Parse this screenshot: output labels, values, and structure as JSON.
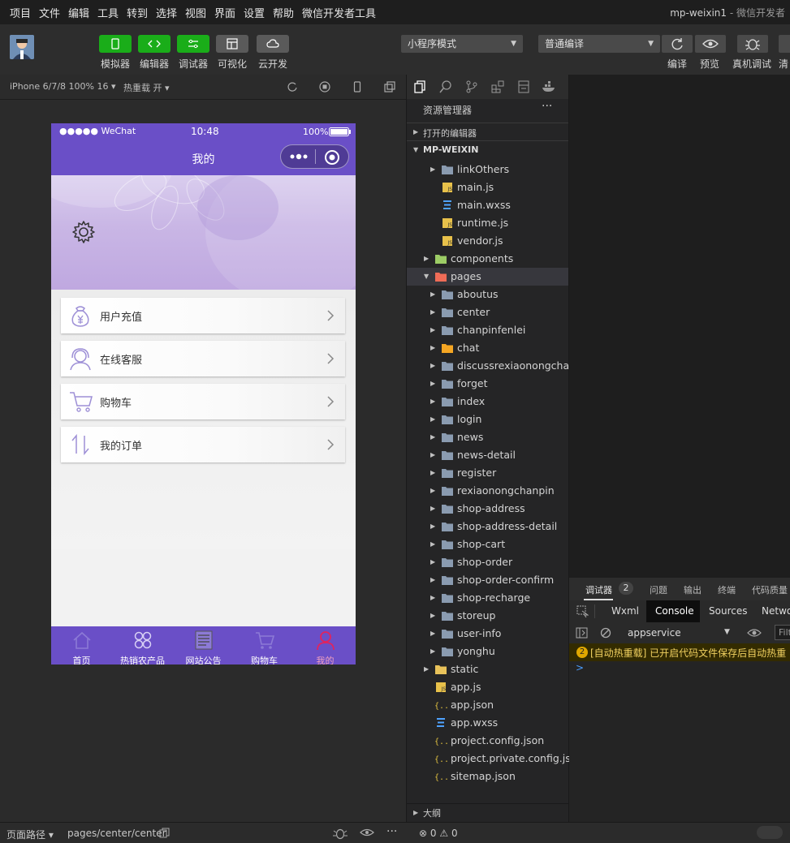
{
  "menubar": {
    "items": [
      "项目",
      "文件",
      "编辑",
      "工具",
      "转到",
      "选择",
      "视图",
      "界面",
      "设置",
      "帮助",
      "微信开发者工具"
    ],
    "window_title": "mp-weixin1",
    "window_title_suffix": " - 微信开发者"
  },
  "toolbar": {
    "buttons": [
      {
        "label": "模拟器",
        "icon": "phone-icon"
      },
      {
        "label": "编辑器",
        "icon": "code-icon"
      },
      {
        "label": "调试器",
        "icon": "debug-icon"
      },
      {
        "label": "可视化",
        "icon": "layout-icon"
      },
      {
        "label": "云开发",
        "icon": "cloud-icon"
      }
    ],
    "mode_select": "小程序模式",
    "compile_select": "普通编译",
    "right_labels": [
      "编译",
      "预览",
      "真机调试",
      "清"
    ]
  },
  "simulator": {
    "device": "iPhone 6/7/8 100% 16",
    "hot_reload": "热重载 开",
    "status": {
      "carrier": "●●●●● WeChat",
      "time": "10:48",
      "battery": "100%"
    },
    "nav_title": "我的",
    "menu_items": [
      {
        "label": "用户充值",
        "icon": "money-bag-icon"
      },
      {
        "label": "在线客服",
        "icon": "customer-service-icon"
      },
      {
        "label": "购物车",
        "icon": "cart-icon"
      },
      {
        "label": "我的订单",
        "icon": "sort-arrows-icon"
      }
    ],
    "tabs": [
      {
        "label": "首页",
        "icon": "home-icon",
        "active": false
      },
      {
        "label": "热销农产品",
        "icon": "grid-icon",
        "active": false
      },
      {
        "label": "网站公告",
        "icon": "news-icon",
        "active": false
      },
      {
        "label": "购物车",
        "icon": "cart-icon",
        "active": false
      },
      {
        "label": "我的",
        "icon": "user-icon",
        "active": true
      }
    ],
    "colors": {
      "primary": "#6a4fc7",
      "active_tab": "#e0245e"
    }
  },
  "explorer": {
    "title": "资源管理器",
    "open_editors": "打开的编辑器",
    "project": "MP-WEIXIN",
    "tree": [
      {
        "name": "linkOthers",
        "type": "folder",
        "depth": 2,
        "expandable": true
      },
      {
        "name": "main.js",
        "type": "js",
        "depth": 2
      },
      {
        "name": "main.wxss",
        "type": "wxss",
        "depth": 2
      },
      {
        "name": "runtime.js",
        "type": "js",
        "depth": 2
      },
      {
        "name": "vendor.js",
        "type": "js",
        "depth": 2
      },
      {
        "name": "components",
        "type": "folder-components",
        "depth": 1,
        "expandable": true
      },
      {
        "name": "pages",
        "type": "folder-pages",
        "depth": 1,
        "expandable": true,
        "expanded": true
      },
      {
        "name": "aboutus",
        "type": "folder",
        "depth": 2,
        "expandable": true
      },
      {
        "name": "center",
        "type": "folder",
        "depth": 2,
        "expandable": true
      },
      {
        "name": "chanpinfenlei",
        "type": "folder",
        "depth": 2,
        "expandable": true
      },
      {
        "name": "chat",
        "type": "folder-chat",
        "depth": 2,
        "expandable": true
      },
      {
        "name": "discussrexiaonongcha...",
        "type": "folder",
        "depth": 2,
        "expandable": true
      },
      {
        "name": "forget",
        "type": "folder",
        "depth": 2,
        "expandable": true
      },
      {
        "name": "index",
        "type": "folder",
        "depth": 2,
        "expandable": true
      },
      {
        "name": "login",
        "type": "folder",
        "depth": 2,
        "expandable": true
      },
      {
        "name": "news",
        "type": "folder",
        "depth": 2,
        "expandable": true
      },
      {
        "name": "news-detail",
        "type": "folder",
        "depth": 2,
        "expandable": true
      },
      {
        "name": "register",
        "type": "folder",
        "depth": 2,
        "expandable": true
      },
      {
        "name": "rexiaonongchanpin",
        "type": "folder",
        "depth": 2,
        "expandable": true
      },
      {
        "name": "shop-address",
        "type": "folder",
        "depth": 2,
        "expandable": true
      },
      {
        "name": "shop-address-detail",
        "type": "folder",
        "depth": 2,
        "expandable": true
      },
      {
        "name": "shop-cart",
        "type": "folder",
        "depth": 2,
        "expandable": true
      },
      {
        "name": "shop-order",
        "type": "folder",
        "depth": 2,
        "expandable": true
      },
      {
        "name": "shop-order-confirm",
        "type": "folder",
        "depth": 2,
        "expandable": true
      },
      {
        "name": "shop-recharge",
        "type": "folder",
        "depth": 2,
        "expandable": true
      },
      {
        "name": "storeup",
        "type": "folder",
        "depth": 2,
        "expandable": true
      },
      {
        "name": "user-info",
        "type": "folder",
        "depth": 2,
        "expandable": true
      },
      {
        "name": "yonghu",
        "type": "folder",
        "depth": 2,
        "expandable": true
      },
      {
        "name": "static",
        "type": "folder-static",
        "depth": 1,
        "expandable": true
      },
      {
        "name": "app.js",
        "type": "js",
        "depth": 1
      },
      {
        "name": "app.json",
        "type": "json",
        "depth": 1
      },
      {
        "name": "app.wxss",
        "type": "wxss",
        "depth": 1
      },
      {
        "name": "project.config.json",
        "type": "json",
        "depth": 1
      },
      {
        "name": "project.private.config.js...",
        "type": "json",
        "depth": 1
      },
      {
        "name": "sitemap.json",
        "type": "json",
        "depth": 1
      }
    ],
    "outline": "大纲"
  },
  "debugger": {
    "tabs": [
      "调试器",
      "问题",
      "输出",
      "终端",
      "代码质量"
    ],
    "badge": "2",
    "devtools_tabs": [
      "Wxml",
      "Console",
      "Sources",
      "Netwo"
    ],
    "context": "appservice",
    "filter_placeholder": "Filt",
    "warning_count": "2",
    "warning_text": "[自动热重载] 已开启代码文件保存后自动热重",
    "prompt": ">"
  },
  "statusbar": {
    "path_label": "页面路径",
    "path": "pages/center/center",
    "errors": "0",
    "warnings": "0"
  }
}
